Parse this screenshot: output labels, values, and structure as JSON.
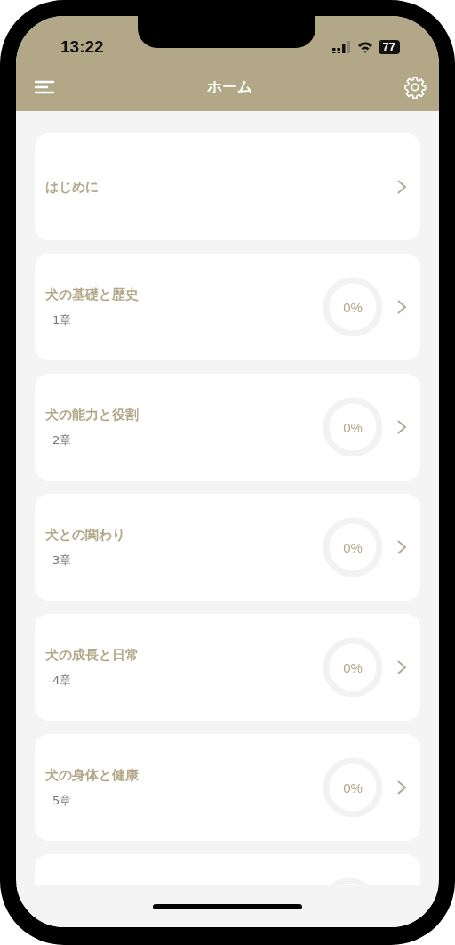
{
  "status_bar": {
    "time": "13:22",
    "battery": "77"
  },
  "nav_bar": {
    "title": "ホーム"
  },
  "cards": [
    {
      "kind": "intro",
      "title": "はじめに"
    },
    {
      "kind": "chapter",
      "title": "犬の基礎と歴史",
      "subtitle": "1章",
      "level": 0,
      "percent": "0%"
    },
    {
      "kind": "chapter",
      "title": "犬の能力と役割",
      "subtitle": "2章",
      "level": 0,
      "percent": "0%"
    },
    {
      "kind": "chapter",
      "title": "犬との関わり",
      "subtitle": "3章",
      "level": 0,
      "percent": "0%"
    },
    {
      "kind": "chapter",
      "title": "犬の成長と日常",
      "subtitle": "4章",
      "level": 0,
      "percent": "0%"
    },
    {
      "kind": "chapter",
      "title": "犬の身体と健康",
      "subtitle": "5章",
      "level": 0,
      "percent": "0%"
    },
    {
      "kind": "partial"
    }
  ]
}
